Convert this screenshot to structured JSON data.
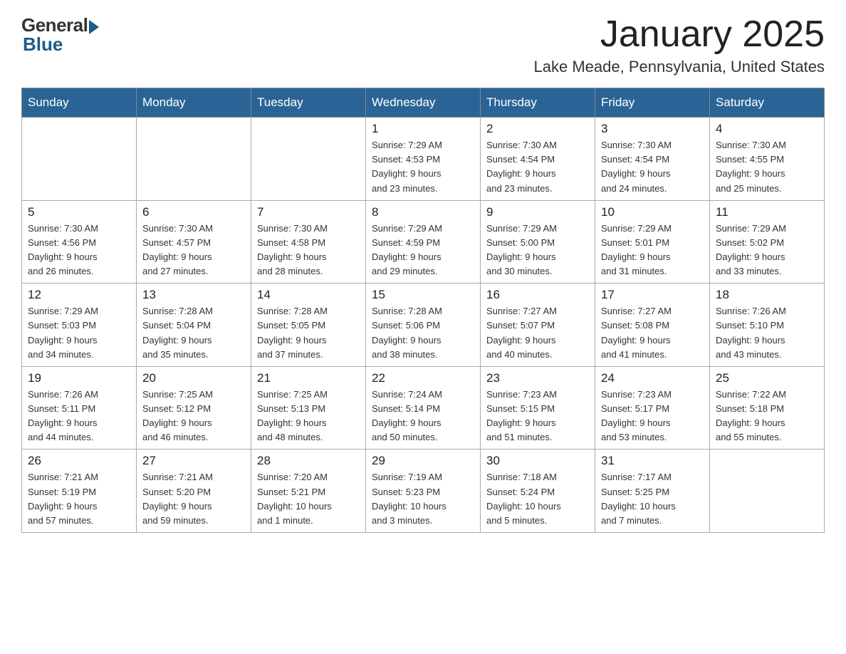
{
  "header": {
    "logo_general": "General",
    "logo_blue": "Blue",
    "month_title": "January 2025",
    "location": "Lake Meade, Pennsylvania, United States"
  },
  "calendar": {
    "headers": [
      "Sunday",
      "Monday",
      "Tuesday",
      "Wednesday",
      "Thursday",
      "Friday",
      "Saturday"
    ],
    "weeks": [
      [
        {
          "day": "",
          "info": ""
        },
        {
          "day": "",
          "info": ""
        },
        {
          "day": "",
          "info": ""
        },
        {
          "day": "1",
          "info": "Sunrise: 7:29 AM\nSunset: 4:53 PM\nDaylight: 9 hours\nand 23 minutes."
        },
        {
          "day": "2",
          "info": "Sunrise: 7:30 AM\nSunset: 4:54 PM\nDaylight: 9 hours\nand 23 minutes."
        },
        {
          "day": "3",
          "info": "Sunrise: 7:30 AM\nSunset: 4:54 PM\nDaylight: 9 hours\nand 24 minutes."
        },
        {
          "day": "4",
          "info": "Sunrise: 7:30 AM\nSunset: 4:55 PM\nDaylight: 9 hours\nand 25 minutes."
        }
      ],
      [
        {
          "day": "5",
          "info": "Sunrise: 7:30 AM\nSunset: 4:56 PM\nDaylight: 9 hours\nand 26 minutes."
        },
        {
          "day": "6",
          "info": "Sunrise: 7:30 AM\nSunset: 4:57 PM\nDaylight: 9 hours\nand 27 minutes."
        },
        {
          "day": "7",
          "info": "Sunrise: 7:30 AM\nSunset: 4:58 PM\nDaylight: 9 hours\nand 28 minutes."
        },
        {
          "day": "8",
          "info": "Sunrise: 7:29 AM\nSunset: 4:59 PM\nDaylight: 9 hours\nand 29 minutes."
        },
        {
          "day": "9",
          "info": "Sunrise: 7:29 AM\nSunset: 5:00 PM\nDaylight: 9 hours\nand 30 minutes."
        },
        {
          "day": "10",
          "info": "Sunrise: 7:29 AM\nSunset: 5:01 PM\nDaylight: 9 hours\nand 31 minutes."
        },
        {
          "day": "11",
          "info": "Sunrise: 7:29 AM\nSunset: 5:02 PM\nDaylight: 9 hours\nand 33 minutes."
        }
      ],
      [
        {
          "day": "12",
          "info": "Sunrise: 7:29 AM\nSunset: 5:03 PM\nDaylight: 9 hours\nand 34 minutes."
        },
        {
          "day": "13",
          "info": "Sunrise: 7:28 AM\nSunset: 5:04 PM\nDaylight: 9 hours\nand 35 minutes."
        },
        {
          "day": "14",
          "info": "Sunrise: 7:28 AM\nSunset: 5:05 PM\nDaylight: 9 hours\nand 37 minutes."
        },
        {
          "day": "15",
          "info": "Sunrise: 7:28 AM\nSunset: 5:06 PM\nDaylight: 9 hours\nand 38 minutes."
        },
        {
          "day": "16",
          "info": "Sunrise: 7:27 AM\nSunset: 5:07 PM\nDaylight: 9 hours\nand 40 minutes."
        },
        {
          "day": "17",
          "info": "Sunrise: 7:27 AM\nSunset: 5:08 PM\nDaylight: 9 hours\nand 41 minutes."
        },
        {
          "day": "18",
          "info": "Sunrise: 7:26 AM\nSunset: 5:10 PM\nDaylight: 9 hours\nand 43 minutes."
        }
      ],
      [
        {
          "day": "19",
          "info": "Sunrise: 7:26 AM\nSunset: 5:11 PM\nDaylight: 9 hours\nand 44 minutes."
        },
        {
          "day": "20",
          "info": "Sunrise: 7:25 AM\nSunset: 5:12 PM\nDaylight: 9 hours\nand 46 minutes."
        },
        {
          "day": "21",
          "info": "Sunrise: 7:25 AM\nSunset: 5:13 PM\nDaylight: 9 hours\nand 48 minutes."
        },
        {
          "day": "22",
          "info": "Sunrise: 7:24 AM\nSunset: 5:14 PM\nDaylight: 9 hours\nand 50 minutes."
        },
        {
          "day": "23",
          "info": "Sunrise: 7:23 AM\nSunset: 5:15 PM\nDaylight: 9 hours\nand 51 minutes."
        },
        {
          "day": "24",
          "info": "Sunrise: 7:23 AM\nSunset: 5:17 PM\nDaylight: 9 hours\nand 53 minutes."
        },
        {
          "day": "25",
          "info": "Sunrise: 7:22 AM\nSunset: 5:18 PM\nDaylight: 9 hours\nand 55 minutes."
        }
      ],
      [
        {
          "day": "26",
          "info": "Sunrise: 7:21 AM\nSunset: 5:19 PM\nDaylight: 9 hours\nand 57 minutes."
        },
        {
          "day": "27",
          "info": "Sunrise: 7:21 AM\nSunset: 5:20 PM\nDaylight: 9 hours\nand 59 minutes."
        },
        {
          "day": "28",
          "info": "Sunrise: 7:20 AM\nSunset: 5:21 PM\nDaylight: 10 hours\nand 1 minute."
        },
        {
          "day": "29",
          "info": "Sunrise: 7:19 AM\nSunset: 5:23 PM\nDaylight: 10 hours\nand 3 minutes."
        },
        {
          "day": "30",
          "info": "Sunrise: 7:18 AM\nSunset: 5:24 PM\nDaylight: 10 hours\nand 5 minutes."
        },
        {
          "day": "31",
          "info": "Sunrise: 7:17 AM\nSunset: 5:25 PM\nDaylight: 10 hours\nand 7 minutes."
        },
        {
          "day": "",
          "info": ""
        }
      ]
    ]
  }
}
